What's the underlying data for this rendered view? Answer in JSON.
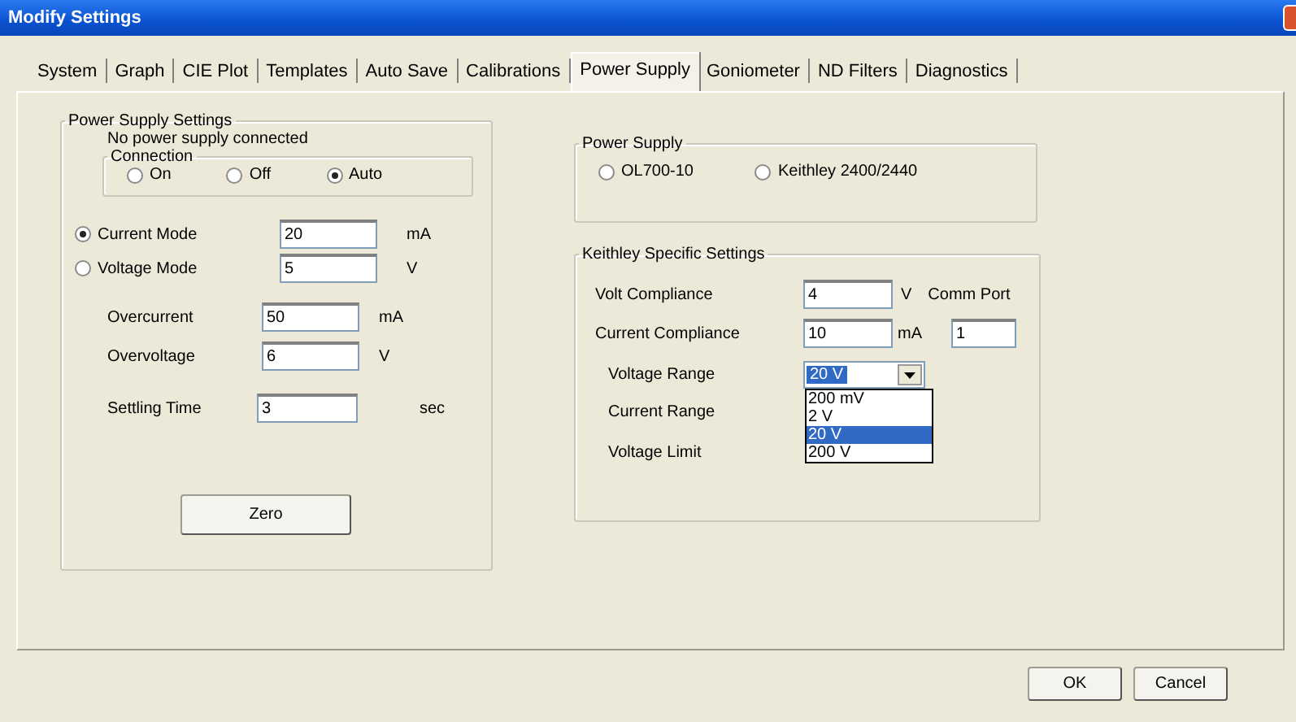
{
  "window": {
    "title": "Modify Settings"
  },
  "tabs": [
    {
      "label": "System",
      "selected": false
    },
    {
      "label": "Graph",
      "selected": false
    },
    {
      "label": "CIE Plot",
      "selected": false
    },
    {
      "label": "Templates",
      "selected": false
    },
    {
      "label": "Auto Save",
      "selected": false
    },
    {
      "label": "Calibrations",
      "selected": false
    },
    {
      "label": "Power Supply",
      "selected": true
    },
    {
      "label": "Goniometer",
      "selected": false
    },
    {
      "label": "ND Filters",
      "selected": false
    },
    {
      "label": "Diagnostics",
      "selected": false
    }
  ],
  "power_supply_settings": {
    "title": "Power Supply Settings",
    "status": "No power supply connected",
    "connection": {
      "title": "Connection",
      "options": [
        {
          "label": "On",
          "selected": false
        },
        {
          "label": "Off",
          "selected": false
        },
        {
          "label": "Auto",
          "selected": true
        }
      ]
    },
    "modes": [
      {
        "label": "Current Mode",
        "selected": true,
        "value": "20",
        "unit": "mA"
      },
      {
        "label": "Voltage Mode",
        "selected": false,
        "value": "5",
        "unit": "V"
      }
    ],
    "limits": [
      {
        "label": "Overcurrent",
        "value": "50",
        "unit": "mA"
      },
      {
        "label": "Overvoltage",
        "value": "6",
        "unit": "V"
      }
    ],
    "settling": {
      "label": "Settling Time",
      "value": "3",
      "unit": "sec"
    },
    "zero_button": "Zero"
  },
  "power_supply": {
    "title": "Power Supply",
    "options": [
      {
        "label": "OL700-10",
        "selected": false
      },
      {
        "label": "Keithley 2400/2440",
        "selected": false
      }
    ]
  },
  "keithley": {
    "title": "Keithley Specific Settings",
    "compliance": [
      {
        "label": "Volt Compliance",
        "value": "4",
        "unit": "V"
      },
      {
        "label": "Current Compliance",
        "value": "10",
        "unit": "mA"
      }
    ],
    "comm_port": {
      "label": "Comm Port",
      "value": "1"
    },
    "voltage_range": {
      "label": "Voltage Range",
      "value": "20 V",
      "expanded": true,
      "options": [
        {
          "label": "200 mV",
          "selected": false
        },
        {
          "label": "2 V",
          "selected": false
        },
        {
          "label": "20 V",
          "selected": true
        },
        {
          "label": "200 V",
          "selected": false
        }
      ]
    },
    "other_labels": [
      "Current Range",
      "Voltage Limit"
    ]
  },
  "buttons": [
    "OK",
    "Cancel"
  ]
}
